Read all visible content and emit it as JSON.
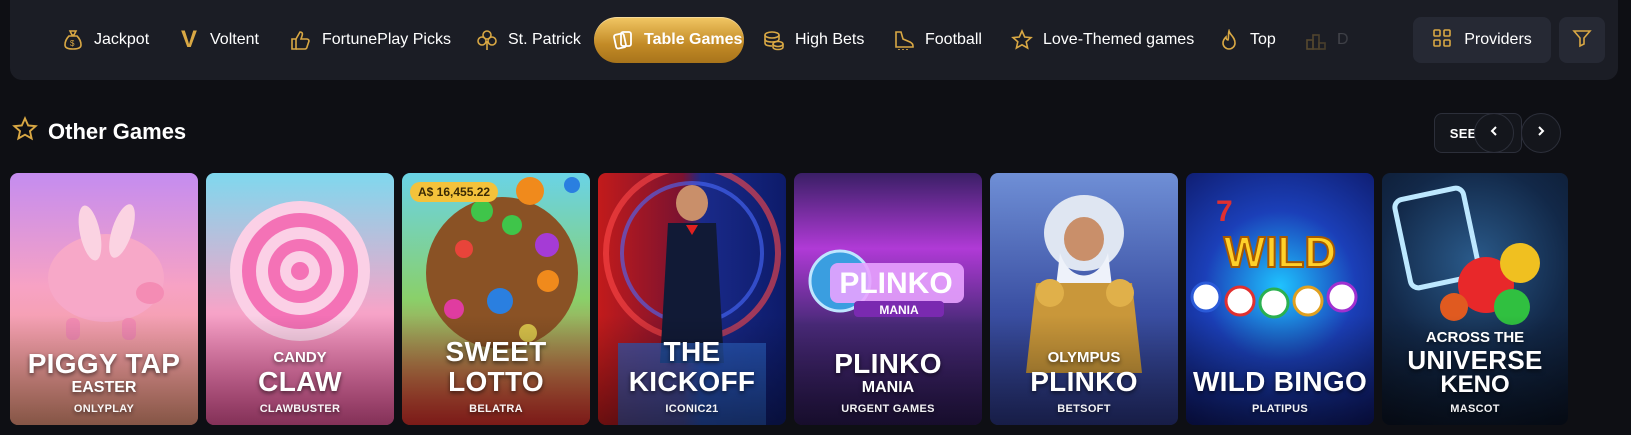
{
  "categories": [
    {
      "label": "Jackpot",
      "icon": "money-bag-icon"
    },
    {
      "label": "Voltent",
      "icon": "voltent-logo-icon"
    },
    {
      "label": "FortunePlay Picks",
      "icon": "thumbs-up-icon"
    },
    {
      "label": "St. Patrick",
      "icon": "clover-icon"
    },
    {
      "label": "Table Games",
      "icon": "cards-icon",
      "active": true
    },
    {
      "label": "High Bets",
      "icon": "coins-icon"
    },
    {
      "label": "Football",
      "icon": "boot-icon"
    },
    {
      "label": "Love-Themed games",
      "icon": "star-icon"
    },
    {
      "label": "Top",
      "icon": "flame-icon"
    },
    {
      "label": "D",
      "icon": "podium-icon"
    }
  ],
  "providers_label": "Providers",
  "section": {
    "title": "Other Games",
    "see_all": "SEE ALL"
  },
  "games": [
    {
      "l1": "",
      "l2": "PIGGY TAP",
      "l3": "EASTER",
      "provider": "ONLYPLAY"
    },
    {
      "l1": "CANDY",
      "l2": "CLAW",
      "l3": "",
      "provider": "CLAWBUSTER"
    },
    {
      "l1": "",
      "l2": "SWEET LOTTO",
      "l3": "",
      "provider": "BELATRA",
      "jackpot": "A$ 16,455.22"
    },
    {
      "l1": "",
      "l2": "THE KICKOFF",
      "l3": "",
      "provider": "ICONIC21"
    },
    {
      "l1": "",
      "l2": "PLINKO",
      "l3": "MANIA",
      "provider": "URGENT GAMES"
    },
    {
      "l1": "OLYMPUS",
      "l2": "PLINKO",
      "l3": "",
      "provider": "BETSOFT"
    },
    {
      "l1": "",
      "l2": "WILD BINGO",
      "l3": "",
      "provider": "PLATIPUS"
    },
    {
      "l1": "ACROSS THE",
      "l2": "UNIVERSE",
      "l3": "KENO",
      "provider": "MASCOT"
    }
  ],
  "colors": {
    "accent": "#d9a844",
    "bg": "#0e0f14",
    "bar": "#1b1d25"
  }
}
